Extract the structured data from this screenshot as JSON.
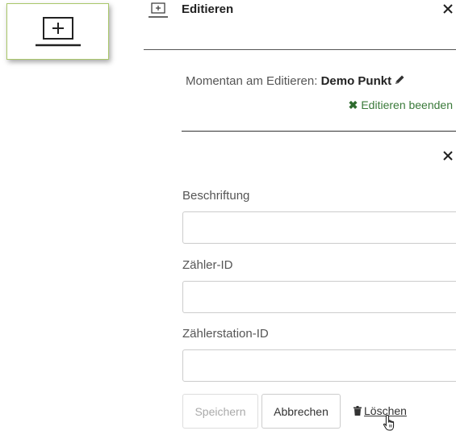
{
  "toolbar": {
    "add_button_icon": "add-frame-icon"
  },
  "header": {
    "icon": "add-frame-icon",
    "title": "Editieren",
    "close_icon": "close-icon"
  },
  "editing": {
    "prefix": "Momentan am Editieren: ",
    "target": "Demo Punkt",
    "target_icon": "pencil-icon",
    "stop_label": "Editieren beenden",
    "stop_icon": "x-mark-icon"
  },
  "form": {
    "close_icon": "close-icon",
    "fields": [
      {
        "label": "Beschriftung",
        "value": ""
      },
      {
        "label": "Zähler-ID",
        "value": ""
      },
      {
        "label": "Zählerstation-ID",
        "value": ""
      }
    ],
    "save_label": "Speichern",
    "cancel_label": "Abbrechen",
    "delete_label": "Löschen",
    "delete_icon": "trash-icon"
  },
  "colors": {
    "tool_border": "#a9c76a",
    "link_green": "#3a7a3a",
    "divider": "#333333"
  }
}
